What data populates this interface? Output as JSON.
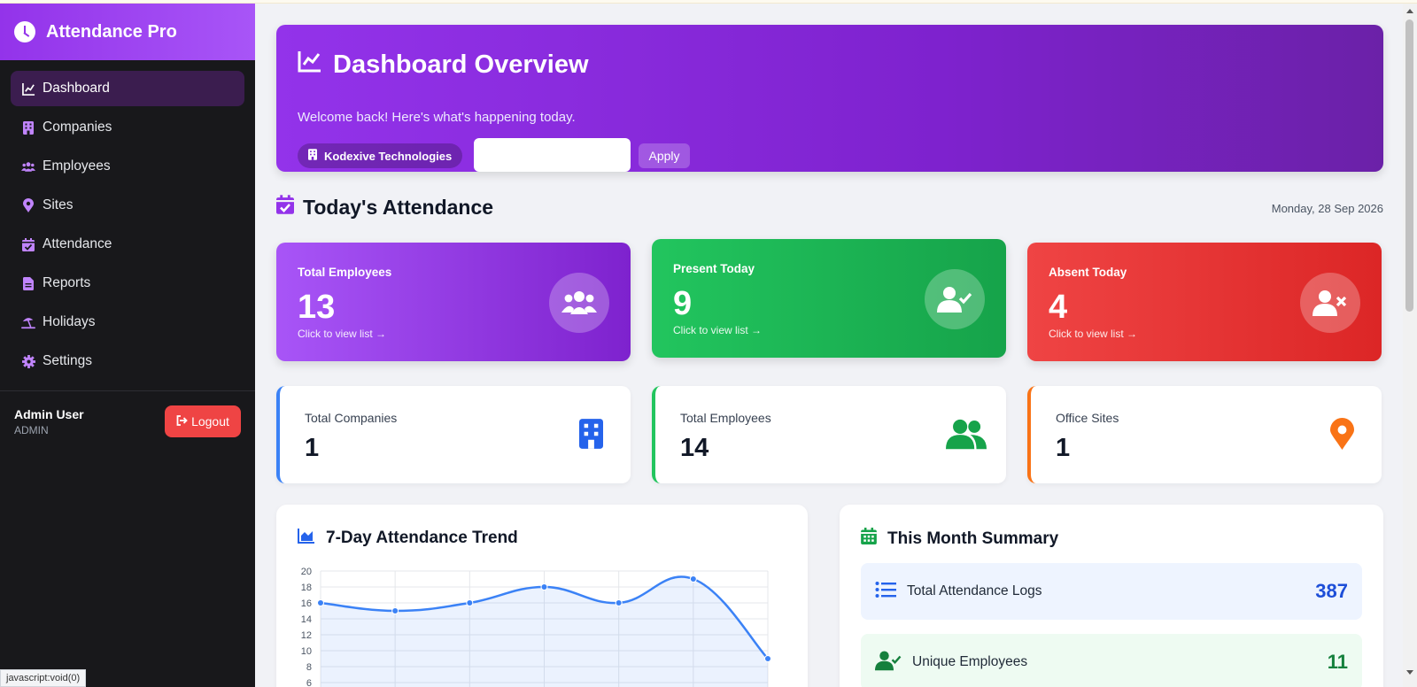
{
  "app": {
    "name": "Attendance Pro"
  },
  "sidebar": {
    "items": [
      {
        "label": "Dashboard",
        "icon": "chart-line-icon",
        "active": true
      },
      {
        "label": "Companies",
        "icon": "building-icon"
      },
      {
        "label": "Employees",
        "icon": "users-icon"
      },
      {
        "label": "Sites",
        "icon": "map-pin-icon"
      },
      {
        "label": "Attendance",
        "icon": "calendar-check-icon"
      },
      {
        "label": "Reports",
        "icon": "file-icon"
      },
      {
        "label": "Holidays",
        "icon": "umbrella-beach-icon"
      },
      {
        "label": "Settings",
        "icon": "gear-icon"
      }
    ],
    "user": {
      "name": "Admin User",
      "role": "ADMIN"
    },
    "logout_label": "Logout"
  },
  "hero": {
    "title": "Dashboard Overview",
    "subtitle": "Welcome back! Here's what's happening today.",
    "company": "Kodexive Technologies",
    "date_value": "",
    "apply_label": "Apply"
  },
  "today": {
    "title": "Today's Attendance",
    "date": "Monday, 28 Sep 2026",
    "cards": [
      {
        "label": "Total Employees",
        "value": "13",
        "link": "Click to view list →",
        "color": "#9333ea"
      },
      {
        "label": "Present Today",
        "value": "9",
        "link": "Click to view list →",
        "color": "#16a34a"
      },
      {
        "label": "Absent Today",
        "value": "4",
        "link": "Click to view list →",
        "color": "#dc2626"
      }
    ]
  },
  "summary_cards": [
    {
      "label": "Total Companies",
      "value": "1",
      "accent": "#3b82f6"
    },
    {
      "label": "Total Employees",
      "value": "14",
      "accent": "#22c55e"
    },
    {
      "label": "Office Sites",
      "value": "1",
      "accent": "#f97316"
    }
  ],
  "trend": {
    "title": "7-Day Attendance Trend"
  },
  "month": {
    "title": "This Month Summary",
    "rows": [
      {
        "label": "Total Attendance Logs",
        "value": "387",
        "color": "#1d4ed8",
        "bg": "#eef4ff"
      },
      {
        "label": "Unique Employees",
        "value": "11",
        "color": "#15803d",
        "bg": "#eefbf2"
      }
    ]
  },
  "statusbar": {
    "text": "javascript:void(0)"
  },
  "chart_data": {
    "type": "line",
    "title": "7-Day Attendance Trend",
    "x": [
      "",
      "",
      "",
      "",
      "",
      "",
      ""
    ],
    "series": [
      {
        "values": [
          16,
          15,
          16,
          18,
          16,
          19,
          9
        ]
      }
    ],
    "ylim": [
      6,
      20
    ],
    "yticks": [
      6,
      8,
      10,
      12,
      14,
      16,
      18,
      20
    ],
    "grid": true,
    "color": "#3b82f6"
  }
}
